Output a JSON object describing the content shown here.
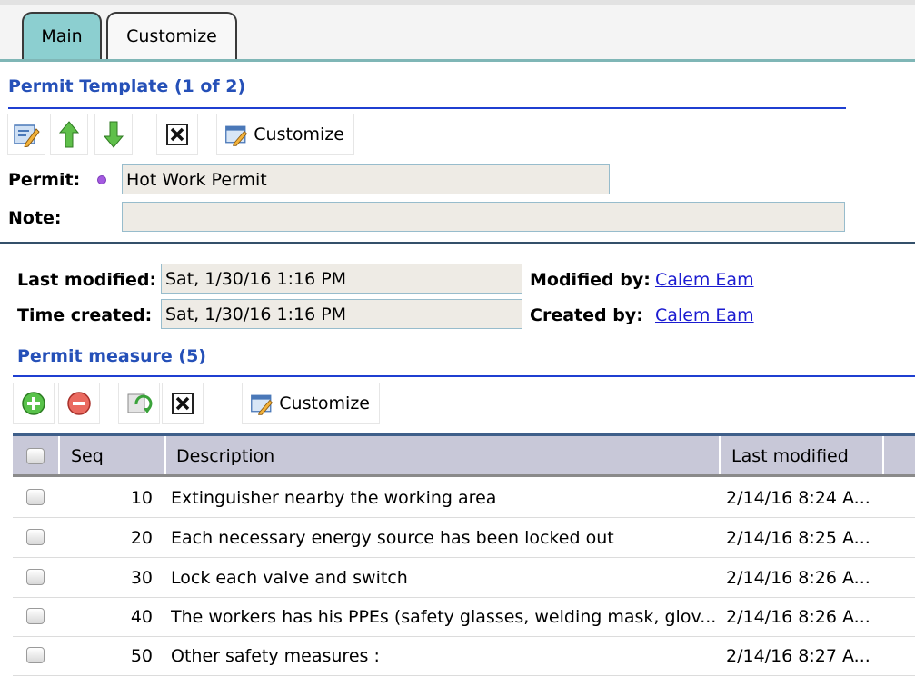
{
  "tabs": [
    {
      "label": "Main",
      "active": true
    },
    {
      "label": "Customize",
      "active": false
    }
  ],
  "permit_template": {
    "title": "Permit Template (1 of 2)",
    "toolbar": {
      "edit_icon": "edit-form-icon",
      "up_icon": "arrow-up-icon",
      "down_icon": "arrow-down-icon",
      "close_icon": "close-box-icon",
      "customize_label": "Customize"
    },
    "permit_label": "Permit:",
    "permit_value": "Hot Work Permit",
    "note_label": "Note:",
    "note_value": ""
  },
  "audit": {
    "last_modified_label": "Last modified:",
    "last_modified_value": "Sat, 1/30/16 1:16 PM",
    "modified_by_label": "Modified by:",
    "modified_by_value": "Calem Eam",
    "time_created_label": "Time created:",
    "time_created_value": "Sat, 1/30/16 1:16 PM",
    "created_by_label": "Created by:",
    "created_by_value": "Calem Eam"
  },
  "measures": {
    "title": "Permit measure (5)",
    "toolbar": {
      "add_icon": "add-circle-icon",
      "remove_icon": "remove-circle-icon",
      "refresh_icon": "refresh-icon",
      "close_icon": "close-box-icon",
      "customize_label": "Customize"
    },
    "columns": [
      "Seq",
      "Description",
      "Last modified"
    ],
    "rows": [
      {
        "seq": "10",
        "description": "Extinguisher nearby the working area",
        "last_modified": "2/14/16 8:24 A..."
      },
      {
        "seq": "20",
        "description": "Each necessary energy source has been locked out",
        "last_modified": "2/14/16 8:25 A..."
      },
      {
        "seq": "30",
        "description": "Lock each valve and switch",
        "last_modified": "2/14/16 8:26 A..."
      },
      {
        "seq": "40",
        "description": "The workers has his PPEs (safety glasses, welding mask, glov...",
        "last_modified": "2/14/16 8:26 A..."
      },
      {
        "seq": "50",
        "description": "Other safety measures :",
        "last_modified": "2/14/16 8:27 A..."
      }
    ]
  },
  "colors": {
    "section_title": "#2550b8",
    "active_tab": "#8ccfd0",
    "link": "#1b1bd0",
    "grid_header": "#c8c8d8"
  }
}
